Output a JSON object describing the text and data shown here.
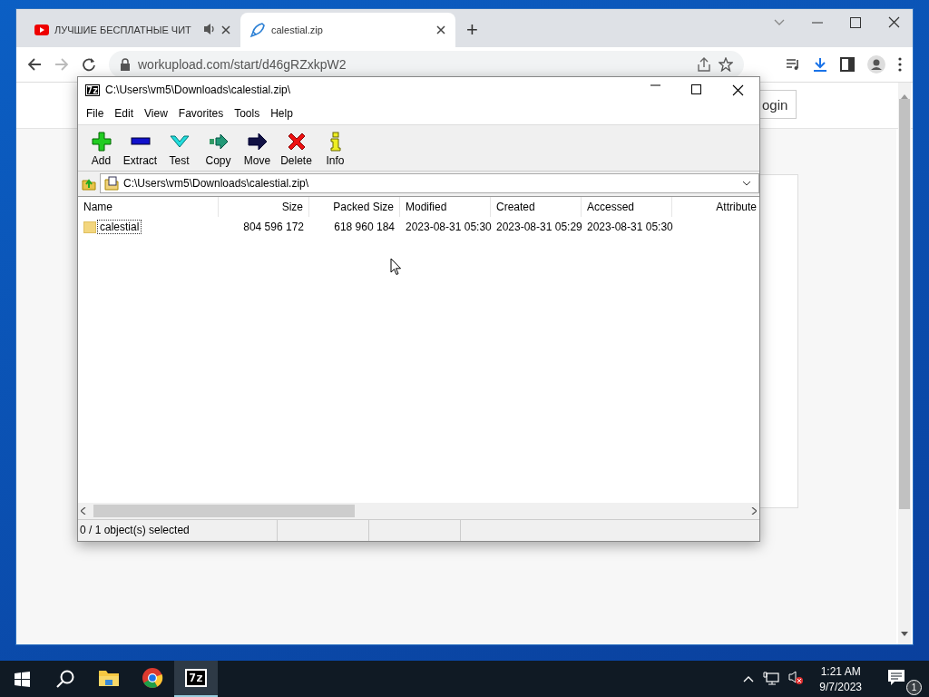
{
  "browser": {
    "tabs": [
      {
        "title": "ЛУЧШИЕ БЕСПЛАТНЫЕ ЧИТ",
        "selected": false,
        "audio": true
      },
      {
        "title": "calestial.zip",
        "selected": true,
        "audio": false
      }
    ],
    "new_tab": "+",
    "url": "workupload.com/start/d46gRZxkpW2",
    "login_button": "ogin"
  },
  "archive_window": {
    "app_icon": "7z",
    "title": "C:\\Users\\vm5\\Downloads\\calestial.zip\\",
    "menu": [
      "File",
      "Edit",
      "View",
      "Favorites",
      "Tools",
      "Help"
    ],
    "toolbar": [
      {
        "label": "Add",
        "kind": "add"
      },
      {
        "label": "Extract",
        "kind": "extract"
      },
      {
        "label": "Test",
        "kind": "test"
      },
      {
        "label": "Copy",
        "kind": "copy"
      },
      {
        "label": "Move",
        "kind": "move"
      },
      {
        "label": "Delete",
        "kind": "delete"
      },
      {
        "label": "Info",
        "kind": "info"
      }
    ],
    "path": "C:\\Users\\vm5\\Downloads\\calestial.zip\\",
    "columns": [
      "Name",
      "Size",
      "Packed Size",
      "Modified",
      "Created",
      "Accessed",
      "Attribute"
    ],
    "rows": [
      {
        "cells": [
          "calestial",
          "804 596 172",
          "618 960 184",
          "2023-08-31 05:30",
          "2023-08-31 05:29",
          "2023-08-31 05:30"
        ],
        "focused": true
      }
    ],
    "status": "0 / 1 object(s) selected"
  },
  "taskbar": {
    "apps": [
      {
        "kind": "explorer",
        "selected": false
      },
      {
        "kind": "chrome",
        "selected": false
      },
      {
        "kind": "sevenzip",
        "label": "7z",
        "selected": true
      }
    ],
    "volume_muted": true,
    "time": "1:21 AM",
    "date": "9/7/2023",
    "notifications": "1"
  }
}
